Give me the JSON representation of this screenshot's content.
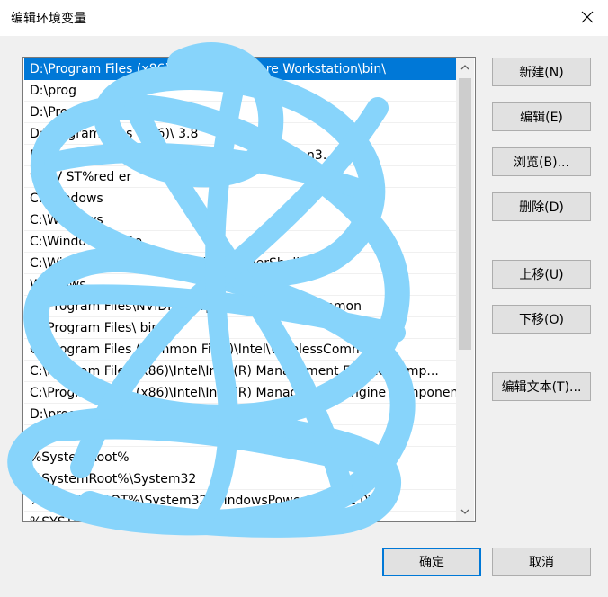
{
  "window": {
    "title": "编辑环境变量",
    "close_glyph": "✕"
  },
  "list": {
    "items": [
      "D:\\Program Files (x86)\\VMware\\VMware Workstation\\bin\\",
      "D:\\prog",
      "D:\\Progr",
      "D:\\Program Files (x86)\\                              3.8",
      "D:\\Program Files (x86)\\                 Studio\\Shared\\Python3...",
      "%                     EV      ST%red              er",
      "C:\\Windows",
      "C:\\Windows",
      "C:\\Windows\\Syste",
      "C:\\Windows\\System32\\WindowsPowerShell\\v1.0",
      "Windows",
      "C:\\Program Files\\NVIDIA Corporation\\PhysX\\Common",
      "C:\\Program Files\\                   bin\\",
      "C:\\Program Files (Common Files)\\Intel\\WirelessCommon\\",
      "C:\\Program Files (x86)\\Intel\\Intel(R) Management Engine Comp...",
      "C:\\Program Files (x86)\\Intel\\Intel(R) Management Engine Componen...",
      "D:\\program\\CMake\\bin",
      "",
      "%SystemRoot%",
      "%SystemRoot%\\System32",
      "%SYSTEMROOT%\\System32\\WindowsPowerShell\\v1.0\\",
      "%SYSTEMROOT%\\System32\\OpenSSH\\"
    ],
    "selected_index": 0
  },
  "buttons": {
    "new": "新建(N)",
    "edit": "编辑(E)",
    "browse": "浏览(B)...",
    "delete": "删除(D)",
    "move_up": "上移(U)",
    "move_down": "下移(O)",
    "edit_text": "编辑文本(T)...",
    "ok": "确定",
    "cancel": "取消"
  },
  "colors": {
    "selection": "#0078d7",
    "scribble": "#87d4fb",
    "background": "#f0f0f0"
  }
}
